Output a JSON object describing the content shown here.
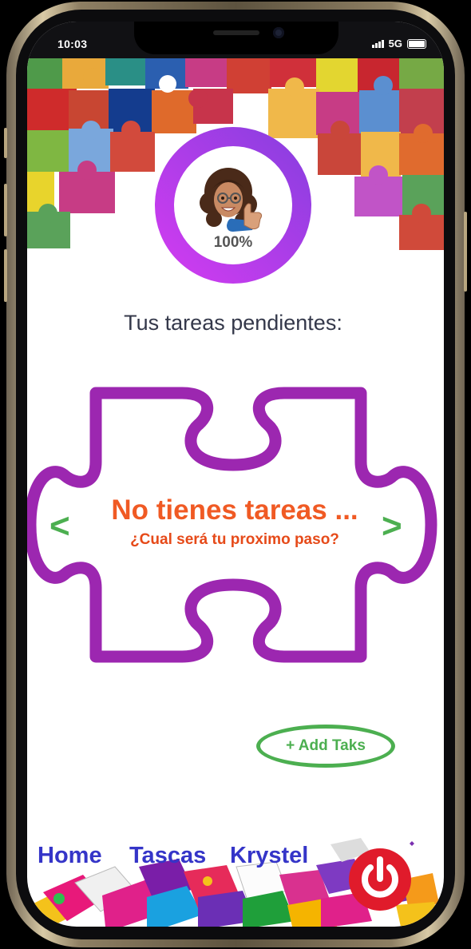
{
  "status_bar": {
    "time": "10:03",
    "network": "5G"
  },
  "progress": {
    "value": 1.0,
    "label": "100%"
  },
  "tasks": {
    "heading": "Tus tareas pendientes:",
    "empty_title": "No tienes tareas ...",
    "empty_subtitle": "¿Cual será tu proximo paso?",
    "prev_label": "<",
    "next_label": ">"
  },
  "add_button": {
    "label": "+ Add Taks"
  },
  "nav": {
    "items": [
      "Home",
      "Tascas",
      "Krystel"
    ]
  },
  "icons": {
    "avatar": "memoji-avatar-thumbs-up",
    "power": "power-icon",
    "signal": "signal-icon",
    "battery": "battery-icon"
  },
  "colors": {
    "ring_start": "#c13ce8",
    "ring_end": "#8a3ee0",
    "puzzle_outline": "#9c27b0",
    "empty_title": "#f05a24",
    "arrows": "#4caf50",
    "add_button": "#4caf50",
    "nav_links": "#3535c8",
    "power_button": "#e01b2b"
  }
}
